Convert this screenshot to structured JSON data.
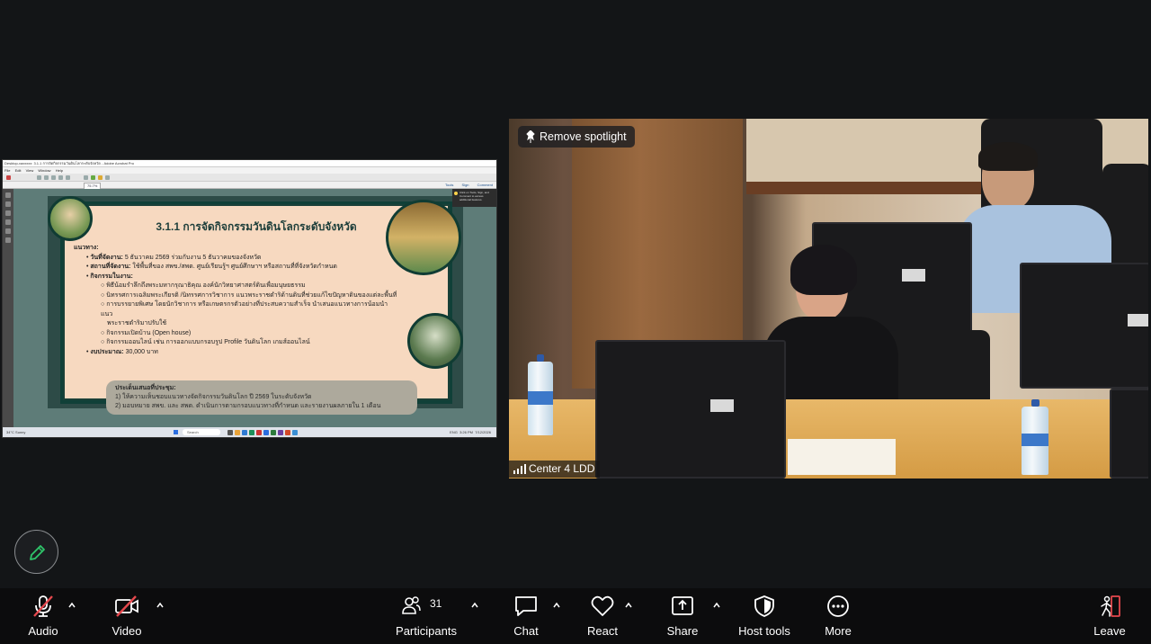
{
  "shared_screen": {
    "window_title": "Desktop-vaxxxxx: 3.1.1 การจัดกิจกรรมวันดินโลกระดับจังหวัด - Adobe Acrobat Pro",
    "menu": [
      "File",
      "Edit",
      "View",
      "Window",
      "Help"
    ],
    "toolbar_right": [
      "Tools",
      "Sign",
      "Comment"
    ],
    "zoom": "75.7%",
    "tooltip": "Click on Tools, Sign, and Comment to access additional features.",
    "slide": {
      "title": "3.1.1 การจัดกิจกรรมวันดินโลกระดับจังหวัด",
      "section": "แนวทาง:",
      "bullets": [
        {
          "label": "วันที่จัดงาน:",
          "text": "5 ธันวาคม 2569 ร่วมกับงาน 5 ธันวาคมของจังหวัด"
        },
        {
          "label": "สถานที่จัดงาน:",
          "text": "ใช้พื้นที่ของ สพข./สพด. ศูนย์เรียนรู้ฯ ศูนย์ศึกษาฯ หรือสถานที่ที่จังหวัดกำหนด"
        },
        {
          "label": "กิจกรรมในงาน:",
          "text": ""
        }
      ],
      "activities": [
        "พิธีน้อมรำลึกถึงพระมหากรุณาธิคุณ องค์นักวิทยาศาสตร์ดินเพื่อมนุษยธรรม",
        "นิทรรศการเฉลิมพระเกียรติ /นิทรรศการวิชาการ แนวพระราชดำริด้านดินที่ช่วยแก้ไขปัญหาดินของแต่ละพื้นที่",
        "การบรรยายพิเศษ โดยนักวิชาการ หรือเกษตรกรตัวอย่างที่ประสบความสำเร็จ นำเสนอแนวทางการน้อมนำแนว",
        "พระราชดำริมาปรับใช้",
        "กิจกรรมเปิดบ้าน (Open house)",
        "กิจกรรมออนไลน์ เช่น การออกแบบกรอบรูป Profile วันดินโลก เกมส์ออนไลน์"
      ],
      "budget_label": "งบประมาณ:",
      "budget_value": "30,000 บาท",
      "note_heading": "ประเด็นเสนอที่ประชุม:",
      "note_items": [
        "1) ให้ความเห็นชอบแนวทางจัดกิจกรรมวันดินโลก ปี 2569 ในระดับจังหวัด",
        "2) มอบหมาย สพข. และ สพด. ดำเนินการตามกรอบแนวทางที่กำหนด และรายงานผลภายใน 1 เดือน"
      ]
    },
    "taskbar": {
      "weather": "34°C Sunny",
      "search": "Search",
      "tray": "ENG",
      "time": "3:26 PM",
      "date": "7/12/2026"
    }
  },
  "video": {
    "spotlight_button": "Remove spotlight",
    "participant_name": "Center 4 LDD"
  },
  "toolbar": {
    "audio": "Audio",
    "video": "Video",
    "participants": "Participants",
    "participants_count": "31",
    "chat": "Chat",
    "react": "React",
    "share": "Share",
    "host_tools": "Host tools",
    "more": "More",
    "leave": "Leave"
  },
  "colors": {
    "background": "#131517",
    "toolbar": "#0c0c0d",
    "leave_red": "#e5484d",
    "muted_red": "#e5484d",
    "pencil_green": "#2fc56a"
  }
}
